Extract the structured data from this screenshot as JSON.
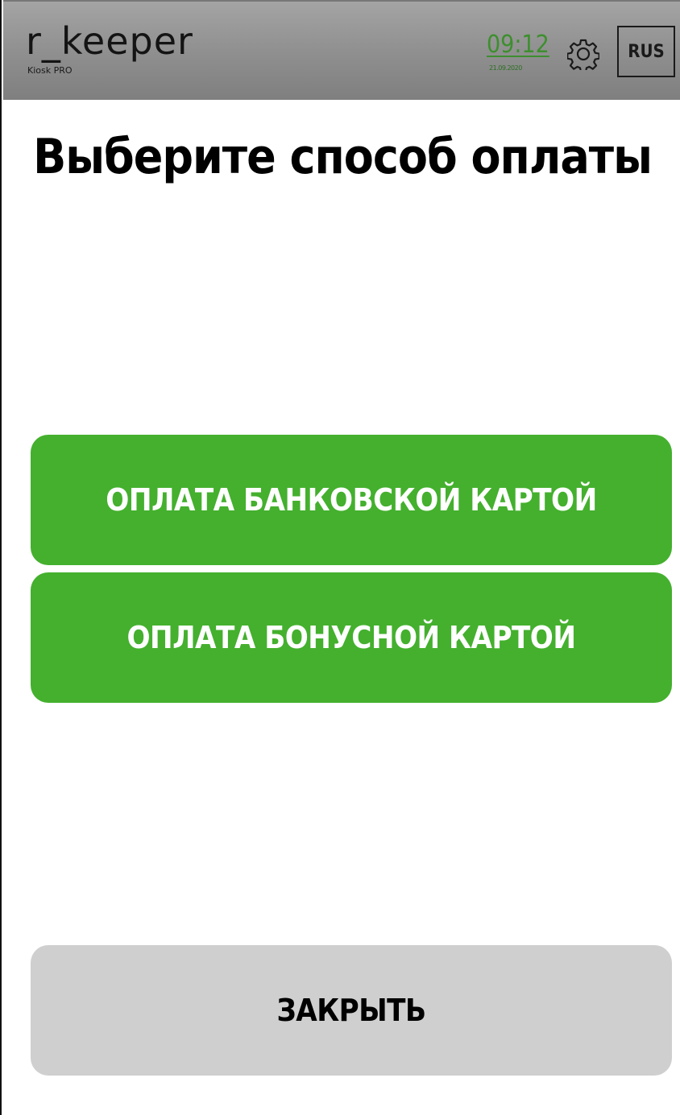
{
  "header": {
    "logo": "r_keeper",
    "logo_sub": "Kiosk PRO",
    "time": "09:12",
    "date": "21.09.2020",
    "settings_icon": "gear-icon",
    "language": "RUS"
  },
  "main": {
    "title": "Выберите способ оплаты",
    "buttons": [
      {
        "label": "ОПЛАТА БАНКОВСКОЙ КАРТОЙ"
      },
      {
        "label": "ОПЛАТА БОНУСНОЙ КАРТОЙ"
      }
    ],
    "close_label": "ЗАКРЫТЬ"
  },
  "colors": {
    "accent_green": "#44b02e",
    "time_green": "#3d8f2e",
    "close_gray": "#cfcfcf",
    "header_gray": "#909090"
  }
}
